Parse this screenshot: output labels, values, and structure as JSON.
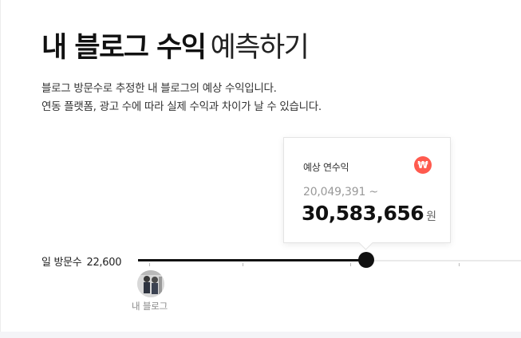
{
  "header": {
    "title_bold": "내 블로그 수익",
    "title_light": "예측하기"
  },
  "description": {
    "line1": "블로그 방문수로 추정한 내 블로그의 예상 수익입니다.",
    "line2": "연동 플랫폼, 광고 수에 따라 실제 수익과 차이가 날 수 있습니다."
  },
  "tooltip": {
    "label": "예상 연수익",
    "icon": "won-icon",
    "icon_glyph": "₩",
    "icon_color": "#ff5a4e",
    "range_start": "20,049,391 ~",
    "value": "30,583,656",
    "unit": "원"
  },
  "slider": {
    "label": "일 방문수",
    "value_text": "22,600",
    "progress": 0.59
  },
  "avatar": {
    "label": "내 블로그"
  }
}
